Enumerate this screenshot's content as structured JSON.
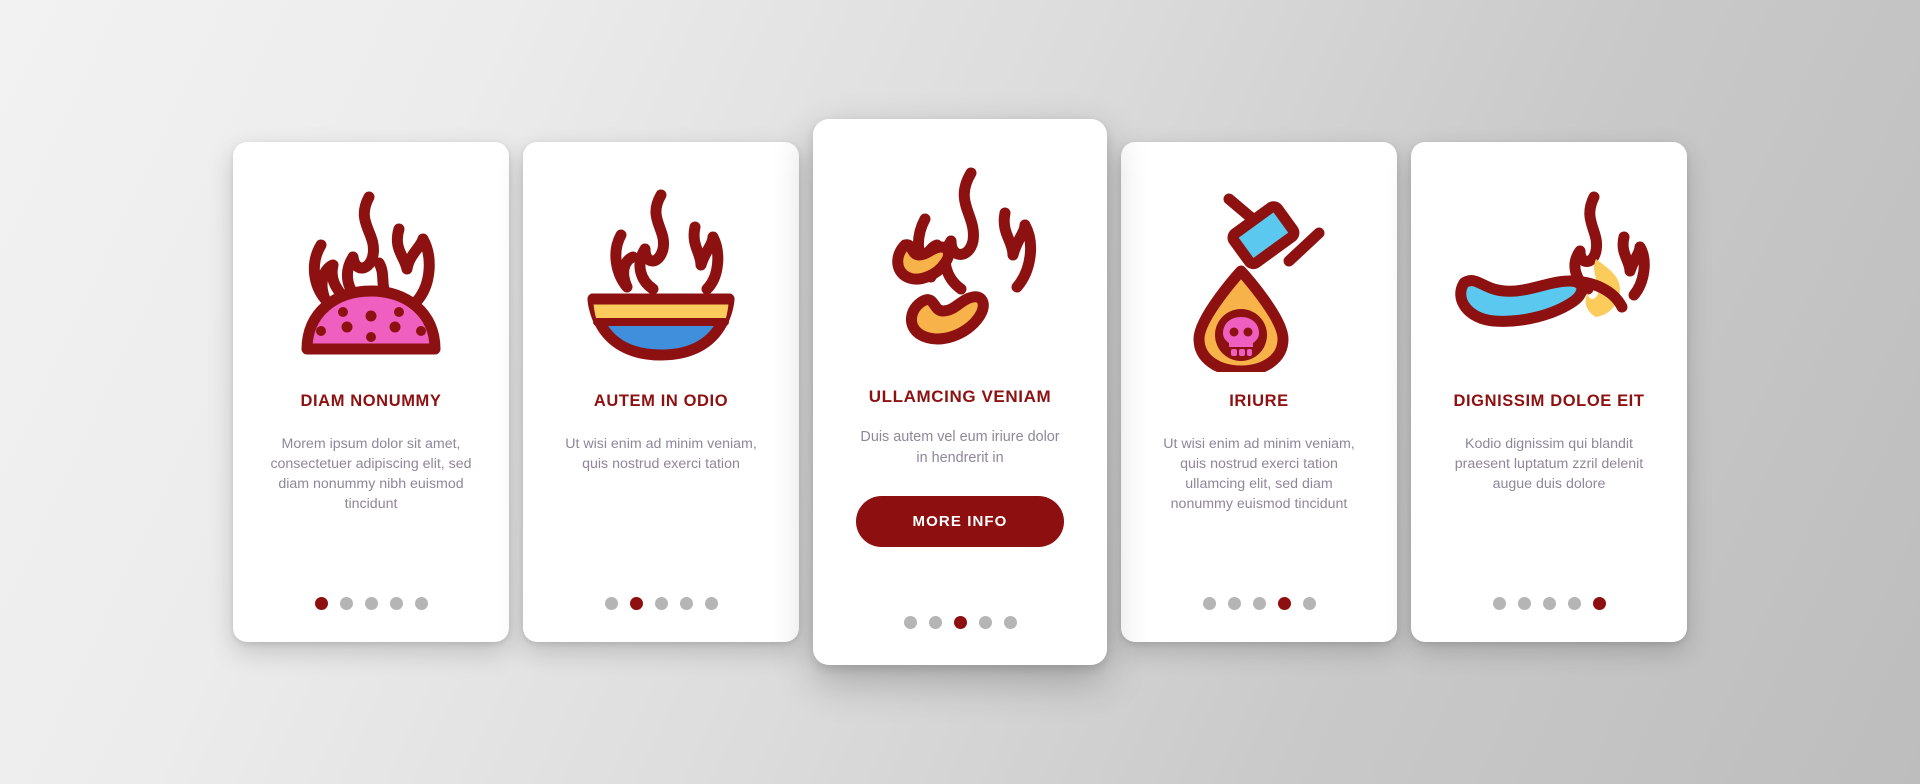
{
  "theme": {
    "accent_dark_red": "#8e0f0f",
    "title_red": "#8e1111",
    "body_gray": "#8f8799",
    "dot_inactive": "#b5b5b5",
    "card_bg": "#ffffff",
    "page_bg_light": "#f2f2f2",
    "page_bg_dark": "#bdbdbd",
    "icon_pink": "#ef5fc0",
    "icon_blue": "#3f8fdc",
    "icon_light_blue": "#5bc8ef",
    "icon_orange": "#f8b24a",
    "icon_yellow": "#fbcc5c"
  },
  "cards": [
    {
      "id": "card-1",
      "icon": "flame-over-chili-mound-icon",
      "title": "DIAM NONUMMY",
      "body": "Morem ipsum dolor sit amet, consectetuer adipiscing elit, sed diam nonummy nibh euismod tincidunt",
      "dots": 5,
      "active_dot": 0,
      "featured": false,
      "button": null
    },
    {
      "id": "card-2",
      "icon": "flaming-bowl-icon",
      "title": "AUTEM IN ODIO",
      "body": "Ut wisi enim ad minim veniam, quis nostrud exerci tation",
      "dots": 5,
      "active_dot": 1,
      "featured": false,
      "button": null
    },
    {
      "id": "card-3",
      "icon": "flaming-chili-peppers-icon",
      "title": "ULLAMCING VENIAM",
      "body": "Duis autem vel eum iriure dolor in hendrerit in",
      "dots": 5,
      "active_dot": 2,
      "featured": true,
      "button": "MORE INFO"
    },
    {
      "id": "card-4",
      "icon": "poison-dropper-skull-icon",
      "title": "IRIURE",
      "body": "Ut wisi enim ad minim veniam, quis nostrud exerci tation ullamcing elit, sed diam nonummy euismod tincidunt",
      "dots": 5,
      "active_dot": 3,
      "featured": false,
      "button": null
    },
    {
      "id": "card-5",
      "icon": "flaming-spoon-icon",
      "title": "DIGNISSIM DOLOE EIT",
      "body": "Kodio dignissim qui blandit praesent luptatum zzril delenit augue duis dolore",
      "dots": 5,
      "active_dot": 4,
      "featured": false,
      "button": null
    }
  ]
}
